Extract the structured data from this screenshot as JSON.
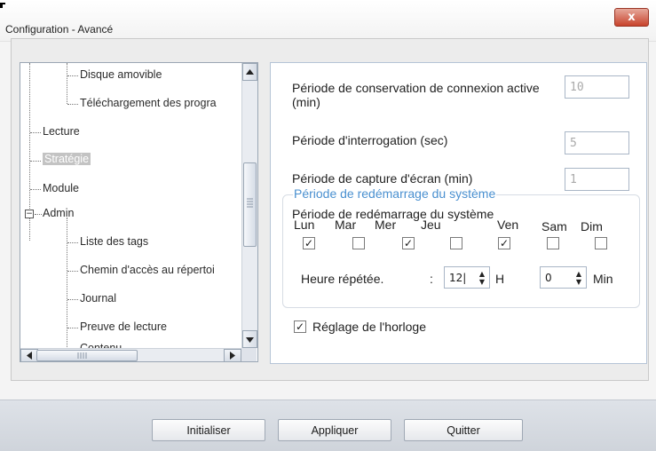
{
  "window": {
    "title": "Configuration - Avancé",
    "close_label": "x"
  },
  "tree": {
    "items": [
      {
        "label": "Disque amovible",
        "selected": false
      },
      {
        "label": "Téléchargement des progra",
        "selected": false
      },
      {
        "label": "Lecture",
        "selected": false
      },
      {
        "label": "Stratégie",
        "selected": true
      },
      {
        "label": "Module",
        "selected": false
      },
      {
        "label": "Admin",
        "selected": false,
        "expanded": true
      },
      {
        "label": "Liste des tags",
        "selected": false
      },
      {
        "label": "Chemin d'accès au répertoi",
        "selected": false
      },
      {
        "label": "Journal",
        "selected": false
      },
      {
        "label": "Preuve de lecture",
        "selected": false
      },
      {
        "label": "Contenu",
        "selected": false
      }
    ],
    "expander_symbol": "−"
  },
  "settings": {
    "connection_period_label": "Période de conservation de connexion active (min)",
    "connection_period_value": "10",
    "poll_period_label": "Période d'interrogation (sec)",
    "poll_period_value": "5",
    "screenshot_period_label": "Période de capture d'écran (min)",
    "screenshot_period_value": "1",
    "restart_group_title": "Période de redémarrage du système",
    "restart_label": "Période de redémarrage du système",
    "days": [
      {
        "label": "Lun",
        "checked": true
      },
      {
        "label": "Mar",
        "checked": false
      },
      {
        "label": "Mer",
        "checked": true
      },
      {
        "label": "Jeu",
        "checked": false
      },
      {
        "label": "Ven",
        "checked": true
      },
      {
        "label": "Sam",
        "checked": false
      },
      {
        "label": "Dim",
        "checked": false
      }
    ],
    "repeat_hour_label": "Heure répétée.",
    "colon": ":",
    "hour_value": "12|",
    "hour_unit": "H",
    "minute_value": "0",
    "minute_unit": "Min",
    "clock_setting_label": "Réglage de l'horloge",
    "clock_setting_checked": true,
    "check_glyph": "✓"
  },
  "buttons": {
    "init": "Initialiser",
    "apply": "Appliquer",
    "quit": "Quitter"
  }
}
